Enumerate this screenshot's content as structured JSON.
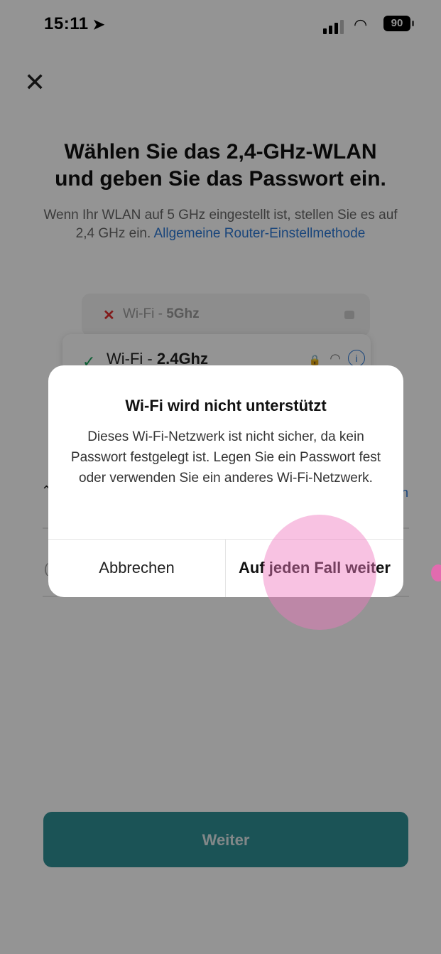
{
  "status_bar": {
    "time": "15:11",
    "battery": "90",
    "location_icon": "location-arrow-icon",
    "signal_icon": "signal-bars-icon",
    "wifi_icon": "wifi-icon"
  },
  "header": {
    "close_icon": "close-icon"
  },
  "title": "Wählen Sie das 2,4-GHz-WLAN und geben Sie das Passwort ein.",
  "subtitle": {
    "text": "Wenn Ihr WLAN auf 5 GHz eingestellt ist, stellen Sie es auf 2,4 GHz ein.",
    "link": "Allgemeine Router-Einstellmethode"
  },
  "wifi_cards": [
    {
      "prefix": "Wi-Fi - ",
      "band": "5Ghz",
      "status": "unsupported"
    },
    {
      "prefix": "Wi-Fi - ",
      "band": "2.4Ghz",
      "status": "supported"
    }
  ],
  "primary_button": "Weiter",
  "dialog": {
    "title": "Wi-Fi wird nicht unterstützt",
    "body": "Dieses Wi-Fi-Netzwerk ist nicht sicher, da kein Passwort festgelegt ist. Legen Sie ein Passwort fest oder verwenden Sie ein anderes Wi-Fi-Netzwerk.",
    "cancel_label": "Abbrechen",
    "continue_label": "Auf jeden Fall weiter"
  },
  "colors": {
    "accent": "#2f8f94",
    "link": "#2b78d4",
    "error": "#e03030",
    "success": "#19a35b",
    "touch_indicator": "#f078be"
  }
}
